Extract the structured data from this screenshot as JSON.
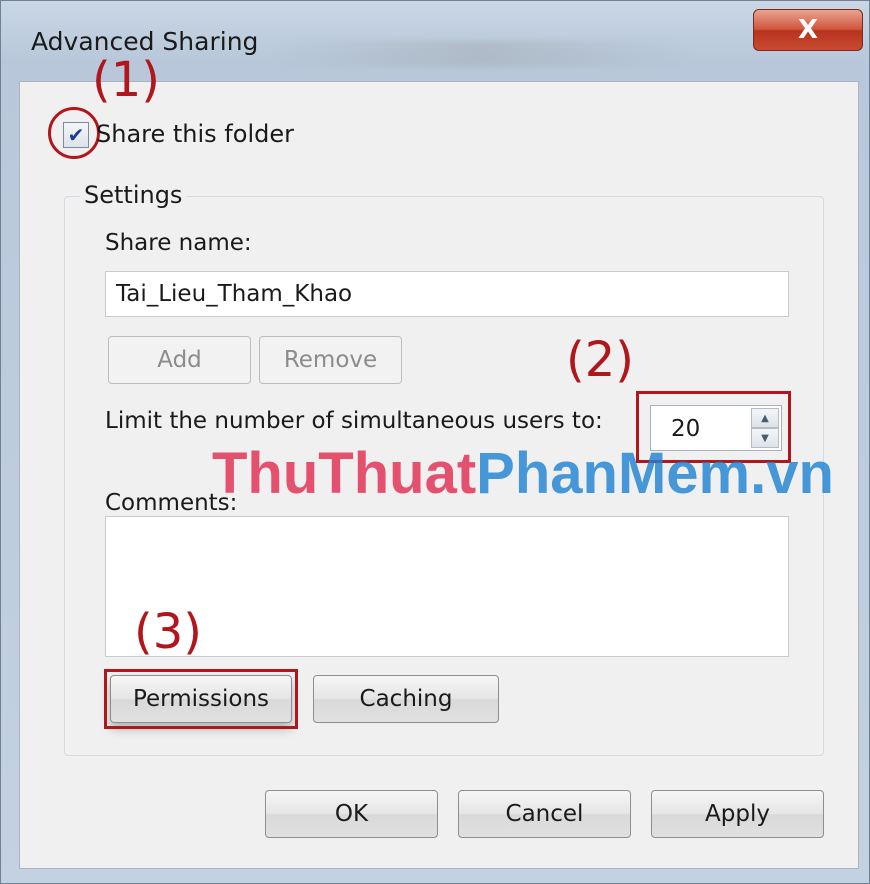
{
  "window": {
    "title": "Advanced Sharing",
    "close_glyph": "X"
  },
  "share": {
    "checkbox_glyph": "✔",
    "checked": true,
    "label": "Share this folder"
  },
  "settings": {
    "group_label": "Settings",
    "share_name_label": "Share name:",
    "share_name_value": "Tai_Lieu_Tham_Khao",
    "add_button": "Add",
    "remove_button": "Remove",
    "limit_label": "Limit the number of simultaneous users to:",
    "limit_value": "20",
    "spin_up_glyph": "▲",
    "spin_down_glyph": "▼",
    "comments_label": "Comments:",
    "comments_value": "",
    "permissions_button": "Permissions",
    "caching_button": "Caching"
  },
  "footer": {
    "ok_button": "OK",
    "cancel_button": "Cancel",
    "apply_button": "Apply"
  },
  "annotations": {
    "step1": "(1)",
    "step2": "(2)",
    "step3": "(3)",
    "color": "#b0161c"
  },
  "watermark": {
    "part1": "ThuThuat",
    "part2": "PhanMem.vn"
  }
}
